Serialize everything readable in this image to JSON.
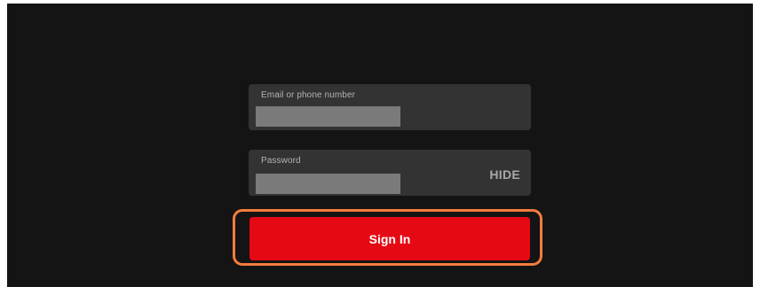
{
  "login_form": {
    "email": {
      "label": "Email or phone number",
      "value": "",
      "placeholder": ""
    },
    "password": {
      "label": "Password",
      "value": "",
      "placeholder": "",
      "toggle_label": "HIDE"
    },
    "submit_label": "Sign In"
  },
  "colors": {
    "background": "#141414",
    "field_background": "#333333",
    "primary_button": "#e50914",
    "highlight_outline": "#f47c3c"
  }
}
